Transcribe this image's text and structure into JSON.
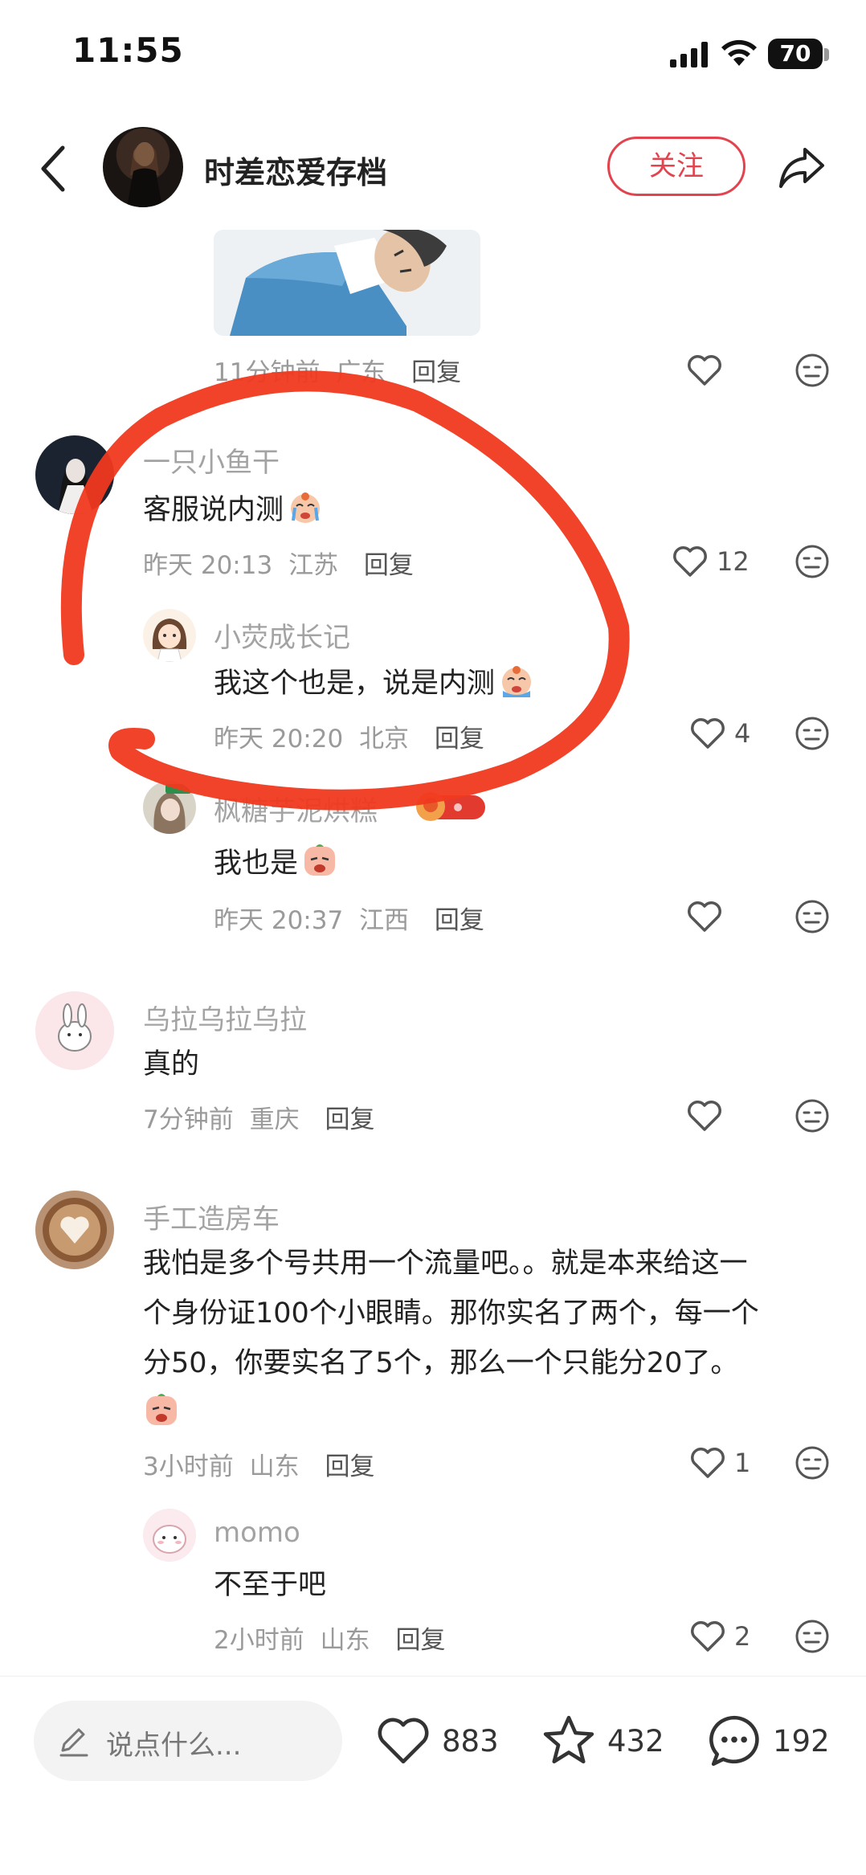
{
  "status_bar": {
    "time": "11:55",
    "battery": "70"
  },
  "header": {
    "title": "时差恋爱存档",
    "follow_label": "关注"
  },
  "sticker_meta": {
    "time": "11分钟前",
    "location": "广东",
    "reply": "回复"
  },
  "comments": [
    {
      "user": "一只小鱼干",
      "text": "客服说内测",
      "time": "昨天 20:13",
      "location": "江苏",
      "reply": "回复",
      "likes": "12",
      "replies": [
        {
          "user": "小荧成长记",
          "text": "我这个也是，说是内测",
          "time": "昨天 20:20",
          "location": "北京",
          "reply": "回复",
          "likes": "4"
        },
        {
          "user": "枫糖芋泥烘糕",
          "text": "我也是",
          "time": "昨天 20:37",
          "location": "江西",
          "reply": "回复",
          "likes": ""
        }
      ]
    },
    {
      "user": "乌拉乌拉乌拉",
      "text": "真的",
      "time": "7分钟前",
      "location": "重庆",
      "reply": "回复",
      "likes": ""
    },
    {
      "user": "手工造房车",
      "text_lines": [
        "我怕是多个号共用一个流量吧。。就是本来给这一",
        "个身份证100个小眼睛。那你实名了两个，每一个",
        "分50，你要实名了5个，那么一个只能分20了。"
      ],
      "time": "3小时前",
      "location": "山东",
      "reply": "回复",
      "likes": "1",
      "replies": [
        {
          "user": "momo",
          "text": "不至于吧",
          "time": "2小时前",
          "location": "山东",
          "reply": "回复",
          "likes": "2"
        }
      ]
    }
  ],
  "bottom_bar": {
    "input_placeholder": "说点什么...",
    "likes": "883",
    "stars": "432",
    "comments": "192"
  },
  "icons": [
    "back-icon",
    "share-icon",
    "heart-icon",
    "dislike-face-icon",
    "pen-icon",
    "star-icon",
    "comment-bubble-icon",
    "cry-emoji-icon",
    "sad-emoji-icon"
  ],
  "colors": {
    "accent": "#e2444f",
    "annotation_stroke": "#f0391f"
  }
}
